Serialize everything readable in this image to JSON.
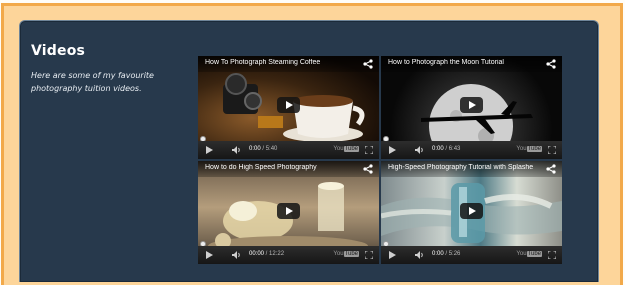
{
  "section": {
    "title": "Videos",
    "description": "Here are some of my favourite photography tuition videos."
  },
  "videos": [
    {
      "title": "How To Photograph Steaming Coffee",
      "time_current": "0:00",
      "time_total": "5:40"
    },
    {
      "title": "How to Photograph the Moon Tutorial",
      "time_current": "0:00",
      "time_total": "6:43"
    },
    {
      "title": "How to do High Speed Photography",
      "time_current": "00:00",
      "time_total": "12:22"
    },
    {
      "title": "High-Speed Photography Tutorial with Splashe",
      "time_current": "0:00",
      "time_total": "5:26"
    }
  ],
  "player": {
    "logo_you": "You",
    "logo_tube": "Tube",
    "time_separator": " / "
  },
  "colors": {
    "frame": "#f2a94a",
    "panel": "#27394c"
  }
}
